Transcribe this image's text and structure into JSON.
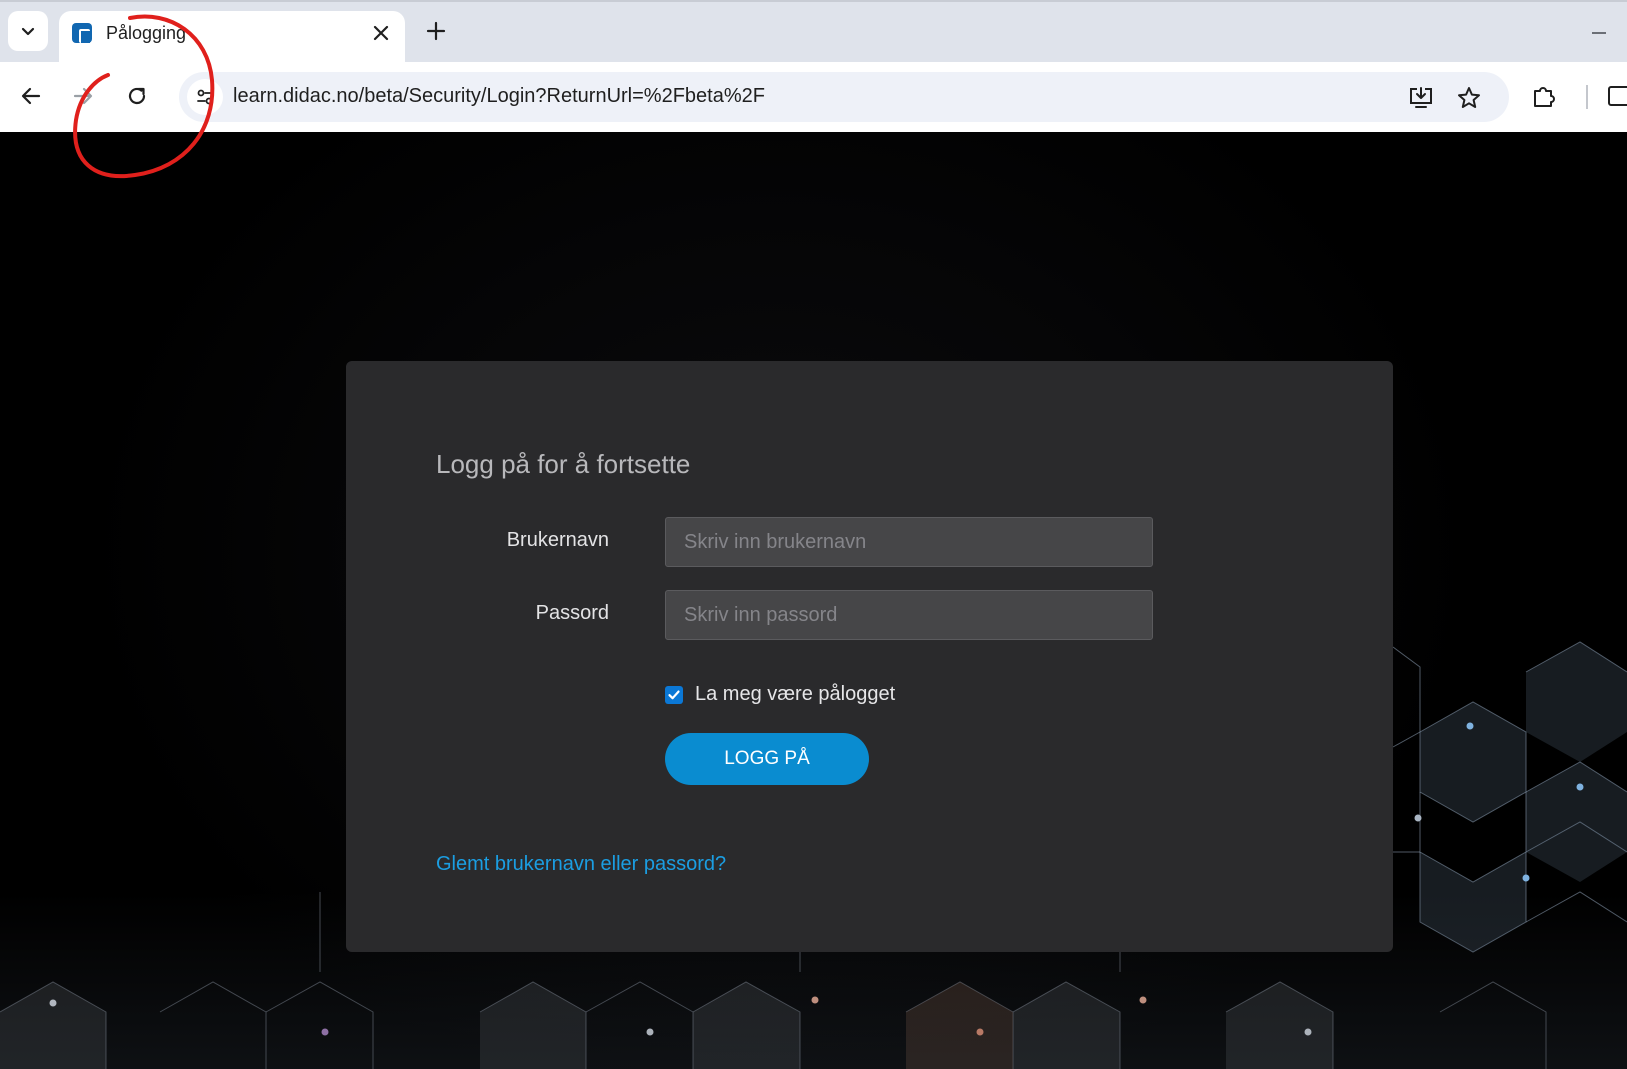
{
  "browser": {
    "tab": {
      "title": "Pålogging"
    },
    "address_bar": {
      "url": "learn.didac.no/beta/Security/Login?ReturnUrl=%2Fbeta%2F"
    }
  },
  "login": {
    "heading": "Logg på for å fortsette",
    "username": {
      "label": "Brukernavn",
      "placeholder": "Skriv inn brukernavn"
    },
    "password": {
      "label": "Passord",
      "placeholder": "Skriv inn passord"
    },
    "remember_me": {
      "label": "La meg være pålogget",
      "checked": true
    },
    "submit_label": "LOGG PÅ",
    "forgot_link": "Glemt brukernavn eller passord?"
  },
  "colors": {
    "accent_button": "#0a8cd0",
    "link": "#1b9ee2",
    "card_background": "#2a2a2c",
    "annotation": "#e0201c"
  }
}
